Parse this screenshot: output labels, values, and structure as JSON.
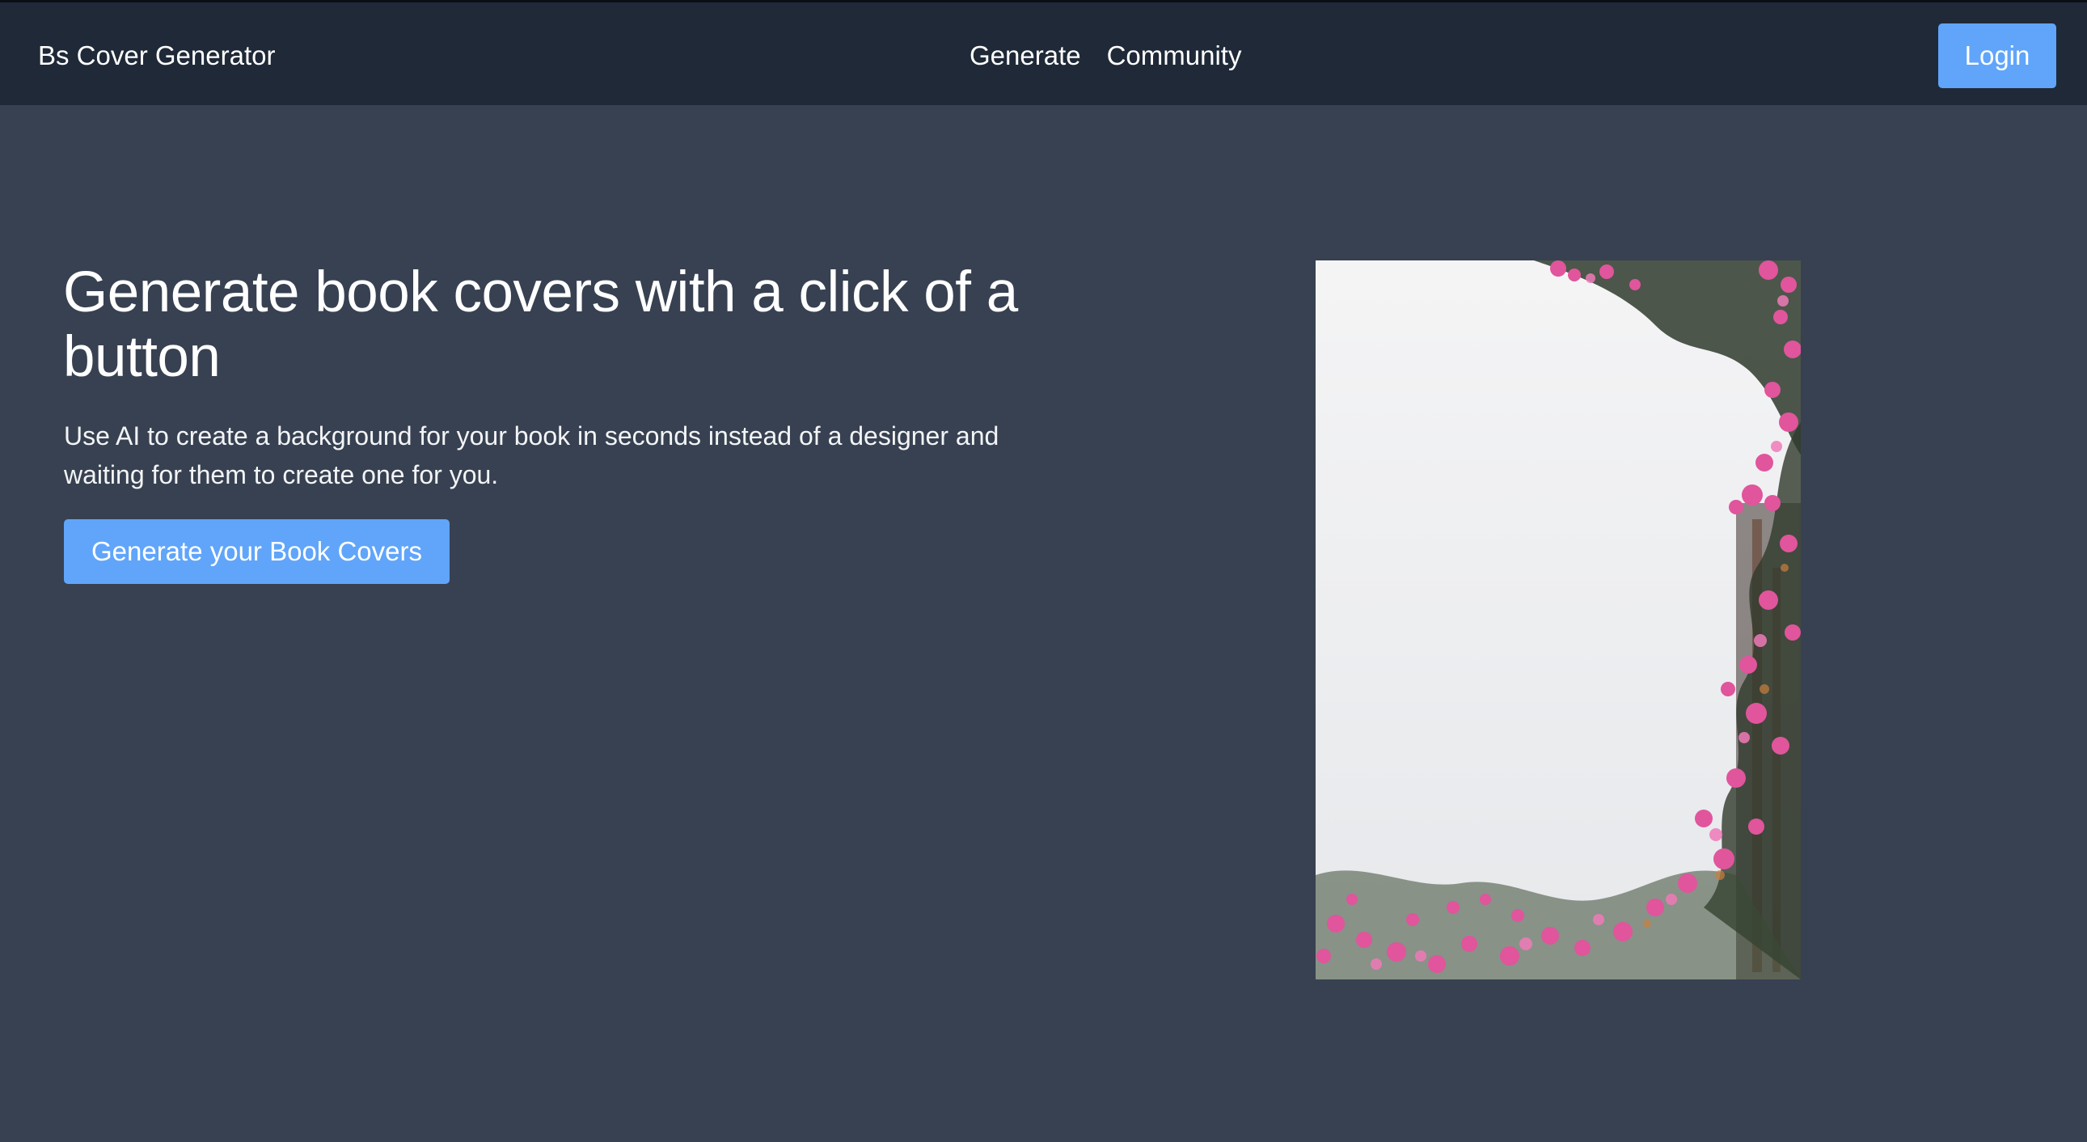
{
  "app": {
    "brand": "Bs Cover Generator"
  },
  "nav": {
    "links": [
      {
        "label": "Generate"
      },
      {
        "label": "Community"
      }
    ],
    "login_label": "Login"
  },
  "hero": {
    "title": "Generate book covers with a click of a button",
    "subtitle": "Use AI to create a background for your book in seconds instead of a designer and waiting for them to create one for you.",
    "cta_label": "Generate your Book Covers"
  },
  "colors": {
    "navbar_bg": "#1f2937",
    "page_bg": "#374151",
    "accent": "#60a5fa",
    "flower_pink": "#e0559c",
    "foliage": "#2f3a2c"
  },
  "cover_preview": {
    "icon": "flower-photo"
  }
}
